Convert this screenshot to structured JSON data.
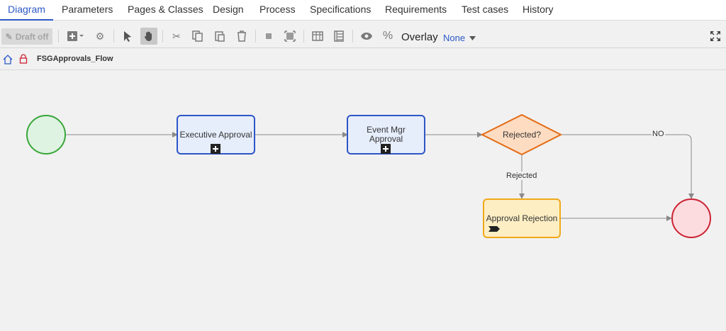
{
  "tabs": [
    {
      "label": "Diagram"
    },
    {
      "label": "Parameters"
    },
    {
      "label": "Pages & Classes"
    },
    {
      "label": "Design"
    },
    {
      "label": "Process"
    },
    {
      "label": "Specifications"
    },
    {
      "label": "Requirements"
    },
    {
      "label": "Test cases"
    },
    {
      "label": "History"
    }
  ],
  "toolbar": {
    "draft_label": "Draft off",
    "overlay_label": "Overlay",
    "overlay_value": "None"
  },
  "breadcrumb": {
    "title": "FSGApprovals_Flow"
  },
  "diagram": {
    "nodes": {
      "executive_approval": "Executive Approval",
      "event_mgr_approval": "Event Mgr Approval",
      "rejected_decision": "Rejected?",
      "approval_rejection": "Approval Rejection"
    },
    "edges": {
      "no_label": "NO",
      "rejected_label": "Rejected"
    }
  },
  "colors": {
    "accent": "#2b58c8",
    "start_fill": "#dff3e2",
    "start_stroke": "#3aa63a",
    "end_fill": "#fddce0",
    "end_stroke": "#cc2233",
    "task_fill": "#e6edfb",
    "task_stroke": "#2f56c6",
    "decision_fill": "#fddcc2",
    "decision_stroke": "#e36b14",
    "subprocess_fill": "#fdeec3",
    "subprocess_stroke": "#f0a81a"
  }
}
